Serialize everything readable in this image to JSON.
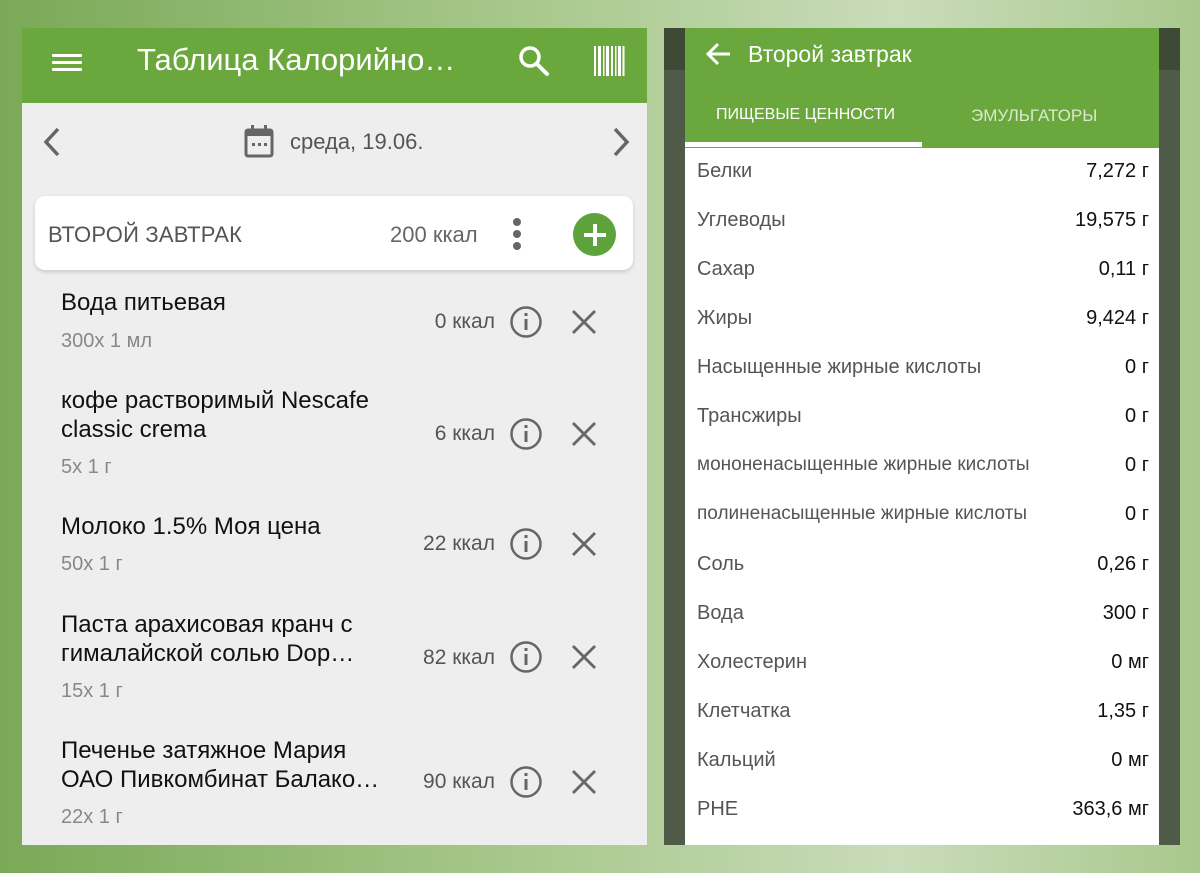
{
  "left": {
    "app_title": "Таблица Калорийно…",
    "date": "среда, 19.06.",
    "meal": {
      "name": "ВТОРОЙ ЗАВТРАК",
      "kcal": "200 ккал"
    },
    "foods": [
      {
        "name": "Вода питьевая",
        "portion": "300x 1 мл",
        "kcal": "0 ккал"
      },
      {
        "name": "кофе растворимый Nescafe classic crema",
        "portion": "5x 1 г",
        "kcal": "6 ккал"
      },
      {
        "name": "Молоко 1.5% Моя цена",
        "portion": "50x 1 г",
        "kcal": "22 ккал"
      },
      {
        "name": "Паста арахисовая кранч с гималайской солью Dop…",
        "portion": "15x 1 г",
        "kcal": "82 ккал"
      },
      {
        "name": "Печенье затяжное Мария ОАО Пивкомбинат Балако…",
        "portion": "22x 1 г",
        "kcal": "90 ккал"
      }
    ]
  },
  "right": {
    "title": "Второй завтрак",
    "tabs": [
      "ПИЩЕВЫЕ ЦЕННОСТИ",
      "ЭМУЛЬГАТОРЫ"
    ],
    "nutrients": [
      {
        "label": "Белки",
        "value": "7,272 г"
      },
      {
        "label": "Углеводы",
        "value": "19,575 г"
      },
      {
        "label": "Сахар",
        "value": "0,11 г"
      },
      {
        "label": "Жиры",
        "value": "9,424 г"
      },
      {
        "label": "Насыщенные жирные кислоты",
        "value": "0 г"
      },
      {
        "label": "Трансжиры",
        "value": "0 г"
      },
      {
        "label": "мононенасыщенные жирные кислоты",
        "value": "0 г"
      },
      {
        "label": "полиненасыщенные жирные кислоты",
        "value": "0 г"
      },
      {
        "label": "Соль",
        "value": "0,26 г"
      },
      {
        "label": "Вода",
        "value": "300 г"
      },
      {
        "label": "Холестерин",
        "value": "0 мг"
      },
      {
        "label": "Клетчатка",
        "value": "1,35 г"
      },
      {
        "label": "Кальций",
        "value": "0 мг"
      },
      {
        "label": "PHE",
        "value": "363,6 мг"
      }
    ]
  },
  "colors": {
    "brand_green": "#6aa83e",
    "add_button": "#5da23a"
  }
}
